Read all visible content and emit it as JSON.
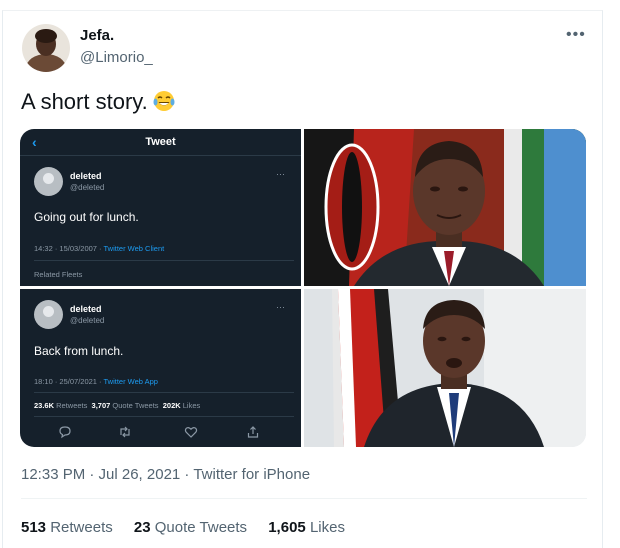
{
  "author": {
    "name": "Jefa.",
    "handle": "@Limorio_"
  },
  "tweet": {
    "text": "A short story.",
    "emoji": "tears-of-joy-emoji",
    "timestamp": "12:33 PM · Jul 26, 2021 · Twitter for iPhone"
  },
  "stats": {
    "retweets_count": "513",
    "retweets_label": "Retweets",
    "quotes_count": "23",
    "quotes_label": "Quote Tweets",
    "likes_count": "1,605",
    "likes_label": "Likes"
  },
  "media": {
    "shot1": {
      "header": "Tweet",
      "name": "deleted",
      "handle": "@deleted",
      "text": "Going out for lunch.",
      "meta_time": "14:32 · 15/03/2007 · ",
      "meta_client": "Twitter Web Client",
      "related": "Related Fleets"
    },
    "shot2": {
      "name": "deleted",
      "handle": "@deleted",
      "text": "Back from lunch.",
      "meta_time": "18:10 · 25/07/2021 · ",
      "meta_client": "Twitter Web App",
      "rt_count": "23.6K",
      "rt_label": "Retweets",
      "qt_count": "3,707",
      "qt_label": "Quote Tweets",
      "like_count": "202K",
      "like_label": "Likes"
    }
  },
  "colors": {
    "accent": "#1d9bf0",
    "text_secondary": "#536471",
    "dark_bg": "#15202b"
  }
}
